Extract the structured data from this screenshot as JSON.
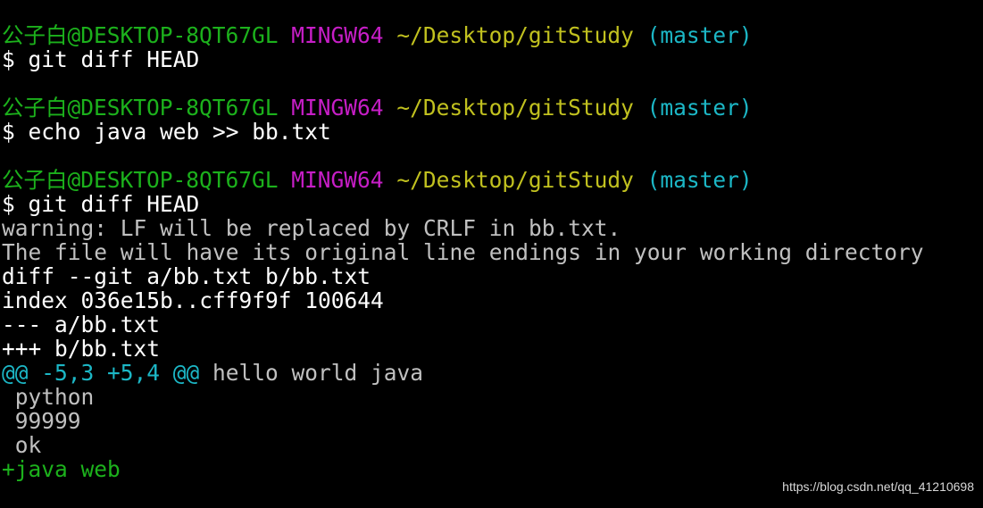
{
  "prompt": {
    "user_host": "公子白@DESKTOP-8QT67GL",
    "system": "MINGW64",
    "path": "~/Desktop/gitStudy",
    "branch": "(master)"
  },
  "blocks": [
    {
      "command": "$ git diff HEAD"
    },
    {
      "command": "$ echo java web >> bb.txt"
    },
    {
      "command": "$ git diff HEAD"
    }
  ],
  "output": {
    "warning_1": "warning: LF will be replaced by CRLF in bb.txt.",
    "warning_2": "The file will have its original line endings in your working directory",
    "diff_header": "diff --git a/bb.txt b/bb.txt",
    "index_line": "index 036e15b..cff9f9f 100644",
    "old_file": "--- a/bb.txt",
    "new_file": "+++ b/bb.txt",
    "hunk_range": "@@ -5,3 +5,4 @@",
    "hunk_context": " hello world java",
    "context_lines": [
      " python",
      " 99999",
      " ok"
    ],
    "added_line": "+java web"
  },
  "watermark": "https://blog.csdn.net/qq_41210698",
  "colors": {
    "background": "#000000",
    "user_host": "#1cb11c",
    "system": "#c71ec7",
    "path": "#c1c11f",
    "branch": "#1cb7c6",
    "hunk": "#1cb7c6",
    "added": "#1cb11c",
    "text": "#c0c0c0"
  }
}
